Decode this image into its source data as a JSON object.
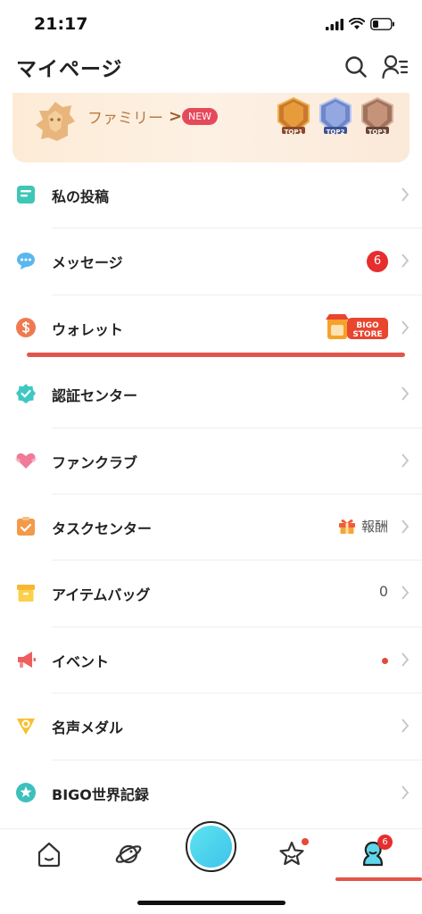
{
  "status_bar": {
    "time": "21:17"
  },
  "header": {
    "title": "マイページ"
  },
  "family_banner": {
    "label": "ファミリー",
    "chevron": ">",
    "badge": "NEW",
    "ranks": [
      "TOP1",
      "TOP2",
      "TOP3"
    ]
  },
  "menu": {
    "posts": {
      "label": "私の投稿"
    },
    "messages": {
      "label": "メッセージ",
      "badge": "6"
    },
    "wallet": {
      "label": "ウォレット",
      "store_text_1": "BIGO",
      "store_text_2": "STORE"
    },
    "verification": {
      "label": "認証センター"
    },
    "fanclub": {
      "label": "ファンクラブ"
    },
    "tasks": {
      "label": "タスクセンター",
      "reward": "報酬"
    },
    "items": {
      "label": "アイテムバッグ",
      "count": "0"
    },
    "events": {
      "label": "イベント"
    },
    "medals": {
      "label": "名声メダル"
    },
    "records": {
      "label": "BIGO世界記録"
    }
  },
  "tabbar": {
    "me_badge": "6"
  },
  "colors": {
    "accent_red": "#e2554a",
    "badge_red": "#e62e2e",
    "live_cyan": "#4fd3ee",
    "banner_bg": "#fdebd6"
  },
  "icons": [
    "search-icon",
    "profile-settings-icon",
    "lion-icon",
    "post-icon",
    "message-icon",
    "wallet-icon",
    "verified-icon",
    "fanclub-icon",
    "task-icon",
    "item-bag-icon",
    "megaphone-icon",
    "medal-icon",
    "world-record-icon",
    "home-icon",
    "planet-icon",
    "star-icon",
    "me-icon",
    "gift-icon"
  ]
}
